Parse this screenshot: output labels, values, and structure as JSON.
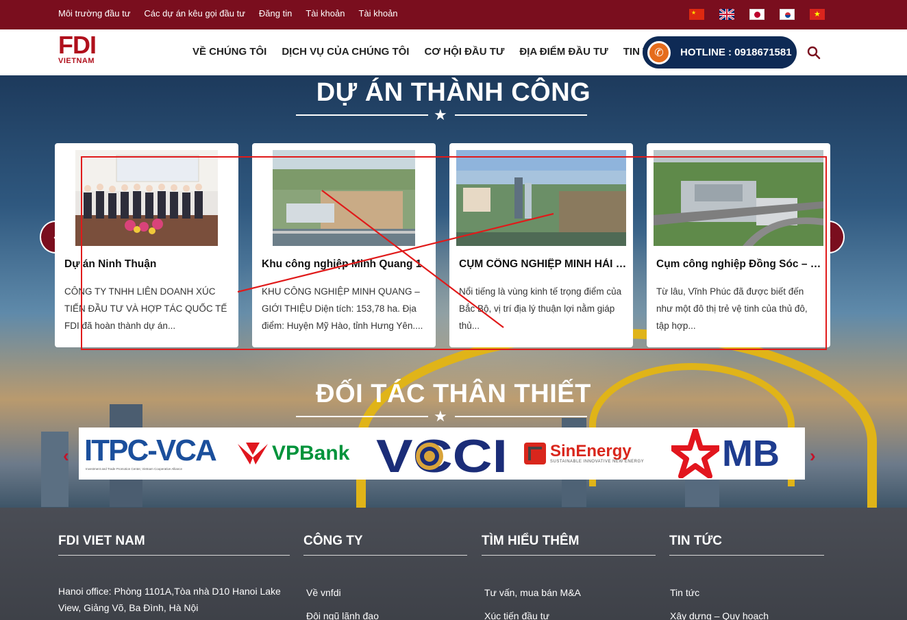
{
  "topbar": {
    "links": [
      "Môi trường đầu tư",
      "Các dự án kêu gọi đầu tư",
      "Đăng tin",
      "Tài khoản",
      "Tài khoản"
    ]
  },
  "header": {
    "logo_main": "FDI",
    "logo_sub": "VIETNAM",
    "nav": [
      "VỀ CHÚNG TÔI",
      "DỊCH VỤ CỦA CHÚNG TÔI",
      "CƠ HỘI ĐẦU TƯ",
      "ĐỊA ĐIỂM ĐẦU TƯ",
      "TIN TỨC"
    ],
    "hotline": "HOTLINE : 0918671581"
  },
  "projects": {
    "title": "DỰ ÁN THÀNH CÔNG",
    "cards": [
      {
        "title": "Dự án Ninh Thuận",
        "desc": "CÔNG TY TNHH LIÊN DOANH XÚC TIẾN ĐẦU TƯ VÀ HỢP TÁC QUỐC TẾ FDI đã hoàn thành dự án..."
      },
      {
        "title": "Khu công nghiệp Minh Quang 1",
        "desc": "KHU CÔNG NGHIỆP MINH QUANG – GIỚI THIỆU Diện tích: 153,78 ha. Địa điểm: Huyện Mỹ Hào, tỉnh Hưng Yên...."
      },
      {
        "title": "CỤM CÔNG NGHIỆP MINH HẢI – VĨNH PHÚC",
        "desc": "Nổi tiếng là vùng kinh tế trọng điểm của Bắc Bộ, vị trí địa lý thuận lợi nằm giáp thủ..."
      },
      {
        "title": "Cụm công nghiệp Đồng Sóc – Vĩnh Phúc",
        "desc": "Từ lâu, Vĩnh Phúc đã được biết đến như một đô thị trẻ vệ tinh của thủ đô, tập hợp..."
      }
    ]
  },
  "partners": {
    "title": "ĐỐI TÁC THÂN THIẾT",
    "logos": {
      "itpc": "ITPC-VCA",
      "itpc_sub": "Investment and Trade Promotion Center, Vietnam Cooperative Alliance",
      "vpbank": "VPBank",
      "vcci": "VCCI",
      "sinenergy": "SinEnergy",
      "sinenergy_sub": "SUSTAINABLE INNOVATIVE NEW ENERGY",
      "mb": "MB"
    }
  },
  "footer": {
    "col1_title": "FDI VIET NAM",
    "col1_addr": "Hanoi office: Phòng 1101A,Tòa nhà D10 Hanoi Lake View, Giảng Võ, Ba Đình, Hà Nội",
    "col2_title": "CÔNG TY",
    "col2_links": [
      "Về vnfdi",
      "Đội ngũ lãnh đạo"
    ],
    "col3_title": "TÌM HIỂU THÊM",
    "col3_links": [
      "Tư vấn, mua bán M&A",
      "Xúc tiến đầu tư"
    ],
    "col4_title": "TIN TỨC",
    "col4_links": [
      "Tin tức",
      "Xây dựng – Quy hoạch"
    ]
  },
  "colors": {
    "brand_red": "#7a0e1e",
    "hotline_navy": "#0e2a55",
    "annotation_red": "#e01a1a"
  }
}
